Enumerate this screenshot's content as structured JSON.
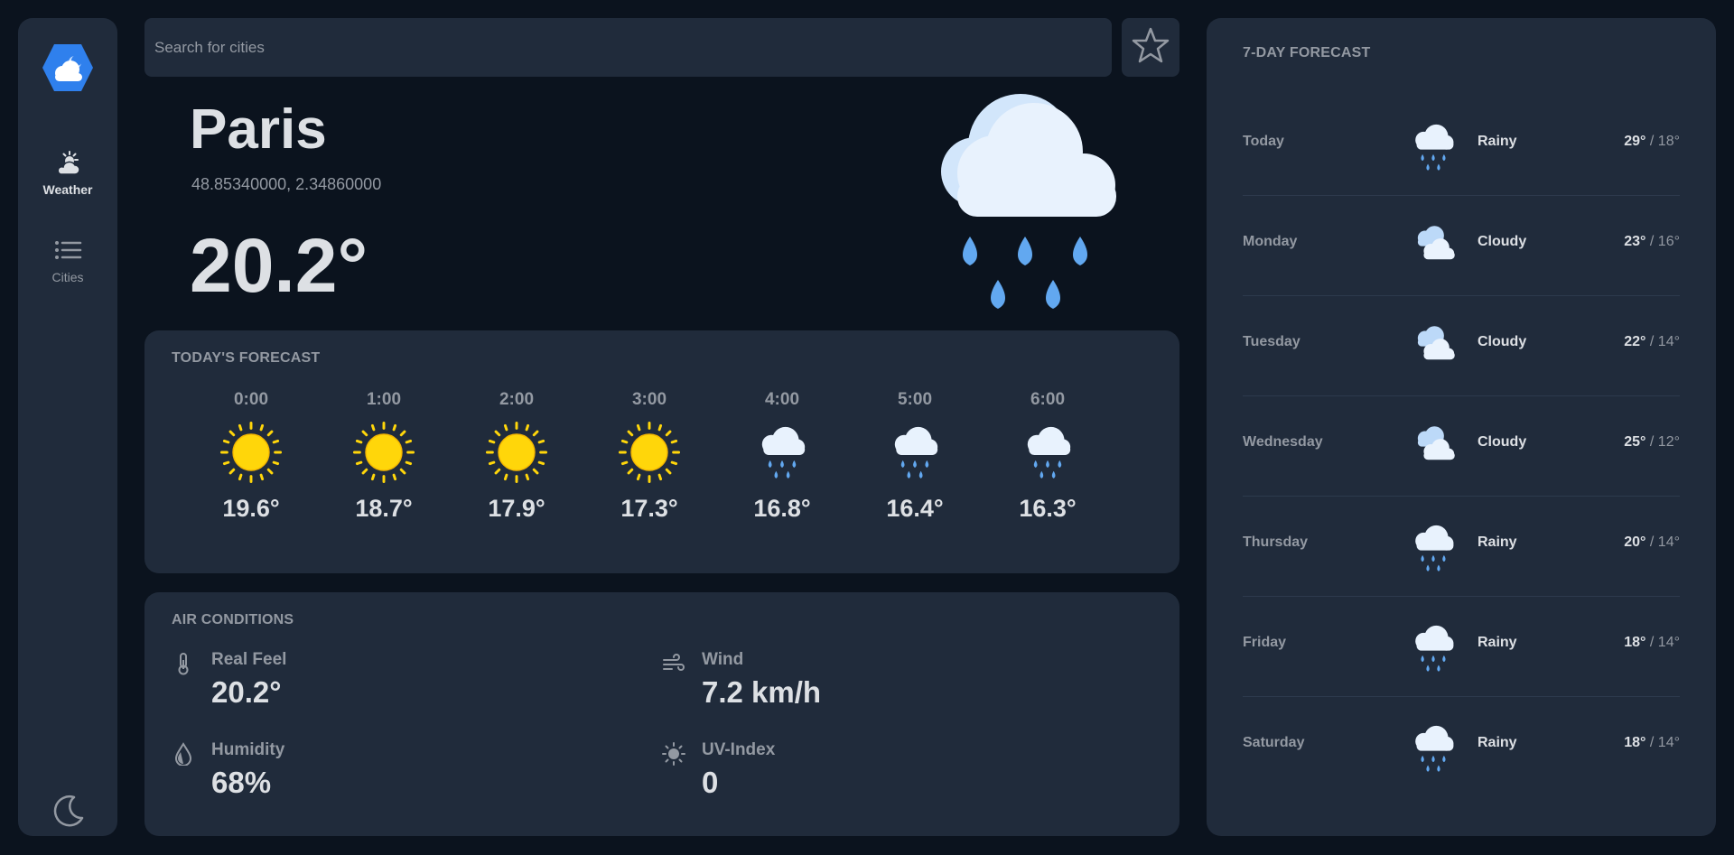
{
  "sidebar": {
    "items": [
      {
        "label": "Weather",
        "icon": "partly-cloudy-icon",
        "active": true
      },
      {
        "label": "Cities",
        "icon": "list-icon",
        "active": false
      }
    ],
    "theme_toggle_icon": "moon-icon"
  },
  "search": {
    "placeholder": "Search for cities",
    "value": ""
  },
  "current": {
    "city": "Paris",
    "coordinates": "48.85340000, 2.34860000",
    "temperature": "20.2°",
    "icon": "rain-icon"
  },
  "today": {
    "title": "TODAY'S FORECAST",
    "hours": [
      {
        "time": "0:00",
        "temp": "19.6°",
        "icon": "sun-icon"
      },
      {
        "time": "1:00",
        "temp": "18.7°",
        "icon": "sun-icon"
      },
      {
        "time": "2:00",
        "temp": "17.9°",
        "icon": "sun-icon"
      },
      {
        "time": "3:00",
        "temp": "17.3°",
        "icon": "sun-icon"
      },
      {
        "time": "4:00",
        "temp": "16.8°",
        "icon": "rain-icon"
      },
      {
        "time": "5:00",
        "temp": "16.4°",
        "icon": "rain-icon"
      },
      {
        "time": "6:00",
        "temp": "16.3°",
        "icon": "rain-icon"
      }
    ]
  },
  "air": {
    "title": "AIR CONDITIONS",
    "real_feel": {
      "label": "Real Feel",
      "value": "20.2°"
    },
    "wind": {
      "label": "Wind",
      "value": "7.2 km/h"
    },
    "humidity": {
      "label": "Humidity",
      "value": "68%"
    },
    "uv": {
      "label": "UV-Index",
      "value": "0"
    }
  },
  "weekly": {
    "title": "7-DAY FORECAST",
    "days": [
      {
        "day": "Today",
        "condition": "Rainy",
        "high": "29°",
        "low": "18°",
        "icon": "rain-icon"
      },
      {
        "day": "Monday",
        "condition": "Cloudy",
        "high": "23°",
        "low": "16°",
        "icon": "cloudy-icon"
      },
      {
        "day": "Tuesday",
        "condition": "Cloudy",
        "high": "22°",
        "low": "14°",
        "icon": "cloudy-icon"
      },
      {
        "day": "Wednesday",
        "condition": "Cloudy",
        "high": "25°",
        "low": "12°",
        "icon": "cloudy-icon"
      },
      {
        "day": "Thursday",
        "condition": "Rainy",
        "high": "20°",
        "low": "14°",
        "icon": "rain-icon"
      },
      {
        "day": "Friday",
        "condition": "Rainy",
        "high": "18°",
        "low": "14°",
        "icon": "rain-icon"
      },
      {
        "day": "Saturday",
        "condition": "Rainy",
        "high": "18°",
        "low": "14°",
        "icon": "rain-icon"
      }
    ]
  },
  "colors": {
    "background": "#0b131e",
    "panel": "#202b3b",
    "text": "#dde0e4",
    "muted": "#9399a2",
    "sun": "#ffd60a",
    "rain": "#62a8f0",
    "cloud": "#e8f2fd",
    "accent": "#2f80ed"
  }
}
